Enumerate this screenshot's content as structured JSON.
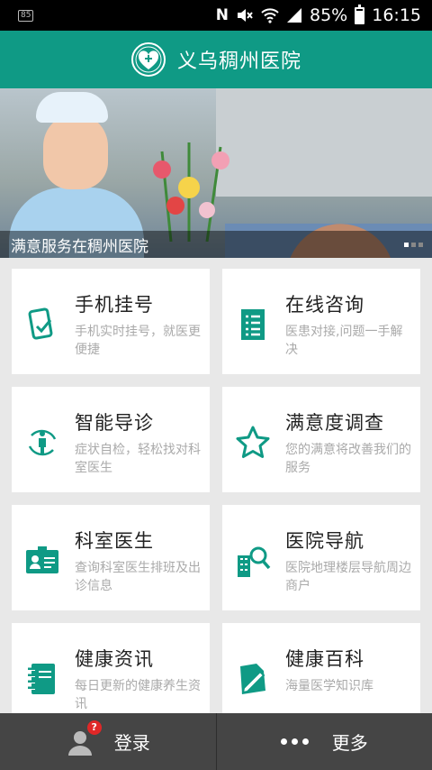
{
  "status_bar": {
    "notification_badge": "85",
    "battery": "85%",
    "time": "16:15",
    "icons": [
      "n-icon",
      "mute-icon",
      "wifi-icon",
      "signal-icon",
      "battery-icon"
    ]
  },
  "header": {
    "title": "义乌稠州医院",
    "logo_icon": "hospital-logo"
  },
  "banner": {
    "caption": "满意服务在稠州医院",
    "slide_count": 3,
    "active_slide": 1
  },
  "cards": [
    {
      "title": "手机挂号",
      "desc": "手机实时挂号，就医更便捷",
      "icon": "phone-register-icon"
    },
    {
      "title": "在线咨询",
      "desc": "医患对接,问题一手解决",
      "icon": "document-list-icon"
    },
    {
      "title": "智能导诊",
      "desc": "症状自检，轻松找对科室医生",
      "icon": "body-rotate-icon"
    },
    {
      "title": "满意度调查",
      "desc": "您的满意将改善我们的服务",
      "icon": "star-icon"
    },
    {
      "title": "科室医生",
      "desc": "查询科室医生排班及出诊信息",
      "icon": "id-card-icon"
    },
    {
      "title": "医院导航",
      "desc": "医院地理楼层导航周边商户",
      "icon": "building-search-icon"
    },
    {
      "title": "健康资讯",
      "desc": "每日更新的健康养生资讯",
      "icon": "notebook-icon"
    },
    {
      "title": "健康百科",
      "desc": "海量医学知识库",
      "icon": "edit-document-icon"
    }
  ],
  "bottom_bar": {
    "login_label": "登录",
    "login_badge": "?",
    "more_label": "更多"
  },
  "colors": {
    "accent": "#0f9a85",
    "bottom_bar": "#454545",
    "badge": "#e02727"
  }
}
